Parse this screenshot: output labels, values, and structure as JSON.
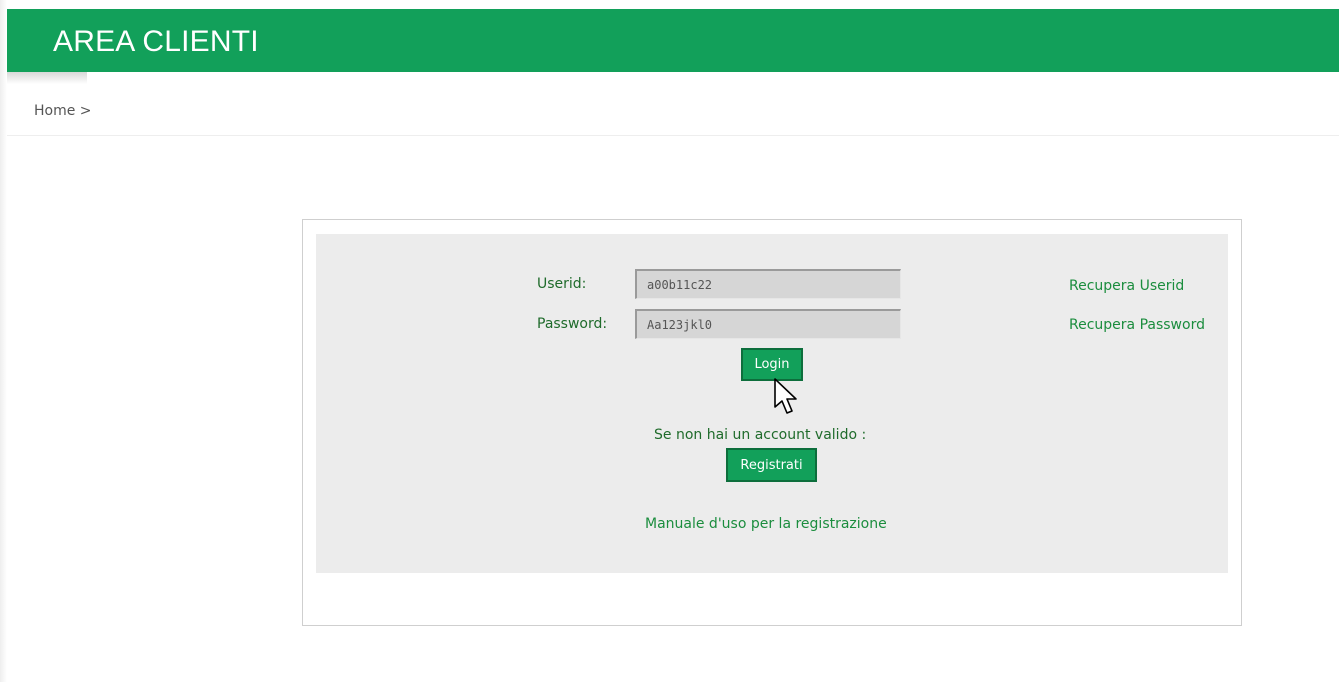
{
  "header": {
    "title": "AREA CLIENTI"
  },
  "breadcrumb": {
    "text": "Home >"
  },
  "login": {
    "userid_label": "Userid:",
    "userid_value": "a00b11c22",
    "password_label": "Password:",
    "password_value": "Aa123jkl0",
    "recover_userid": "Recupera Userid",
    "recover_password": "Recupera Password",
    "login_button": "Login",
    "no_account_text": "Se non hai un account valido :",
    "register_button": "Registrati",
    "manual_link": "Manuale d'uso per la registrazione"
  },
  "colors": {
    "brand_green": "#12a05a",
    "label_green": "#1f6b2b",
    "link_green": "#1b8d3e"
  },
  "icons": {
    "pointer": "mouse-pointer-icon"
  }
}
